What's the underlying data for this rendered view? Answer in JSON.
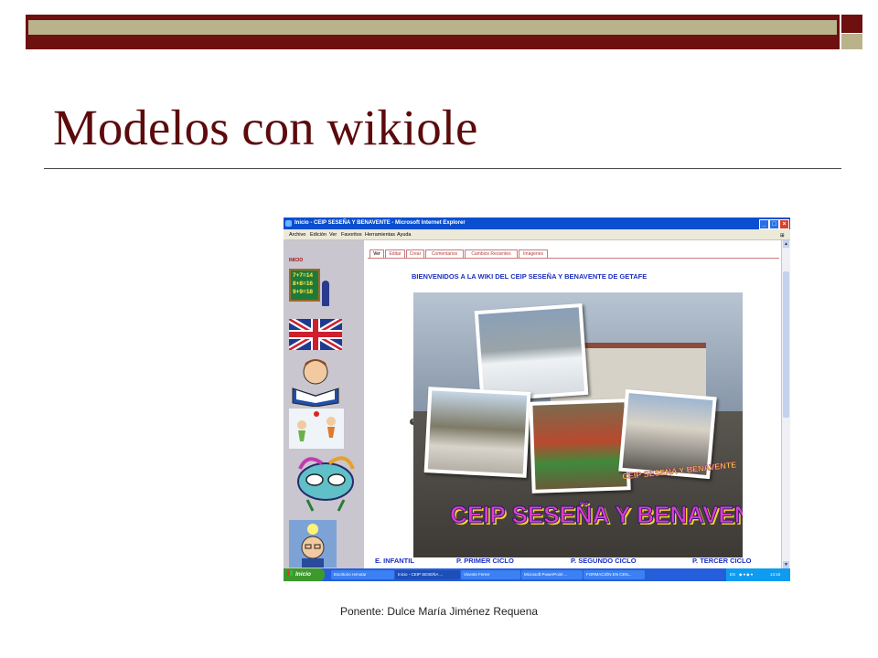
{
  "slide": {
    "title": "Modelos con wikiole",
    "footer": "Ponente: Dulce María  Jiménez Requena",
    "colors": {
      "accent": "#6e0f10",
      "band": "#b9b38c",
      "title": "#5c0a0c"
    }
  },
  "browser": {
    "window_title": "Inicio - CEIP SESEÑA Y BENAVENTE - Microsoft Internet Explorer",
    "menu": [
      "Archivo",
      "Edición",
      "Ver",
      "Favoritos",
      "Herramientas",
      "Ayuda"
    ],
    "window_buttons": [
      "minimize",
      "maximize",
      "close"
    ]
  },
  "wiki": {
    "sidebar_label": "INICIO",
    "tabs": [
      "Ver",
      "Editar",
      "Crear",
      "Comentarios",
      "Cambios Recientes",
      "Imágenes"
    ],
    "active_tab": "Ver",
    "welcome": "BIENVENIDOS A LA WIKI DEL CEIP SESEÑA Y BENAVENTE DE GETAFE",
    "banner": "CEIP SESEÑA Y BENAVENTE",
    "badge": "CEIP SESEÑA Y BENAVENTE",
    "cycles": [
      "E. INFANTIL",
      "P. PRIMER CICLO",
      "P. SEGUNDO CICLO",
      "P. TERCER CICLO"
    ],
    "sidebar_images": [
      {
        "name": "math-board",
        "text": "7+7=14\n8+8=16\n9+9=18"
      },
      {
        "name": "uk-flag"
      },
      {
        "name": "boy-reading"
      },
      {
        "name": "kids-playing"
      },
      {
        "name": "carnival-mask"
      },
      {
        "name": "lightbulb-thinker"
      }
    ]
  },
  "taskbar": {
    "start_label": "Inicio",
    "tasks": [
      "Escritorio remotar",
      "Inicio - CEIP SESEÑA ...",
      "Vicente Ferrer",
      "Microsoft PowerPoint ...",
      "FORMACIÓN EN CEN..."
    ],
    "active_task": 1,
    "tray_lang": "ES",
    "clock": "14:16"
  }
}
